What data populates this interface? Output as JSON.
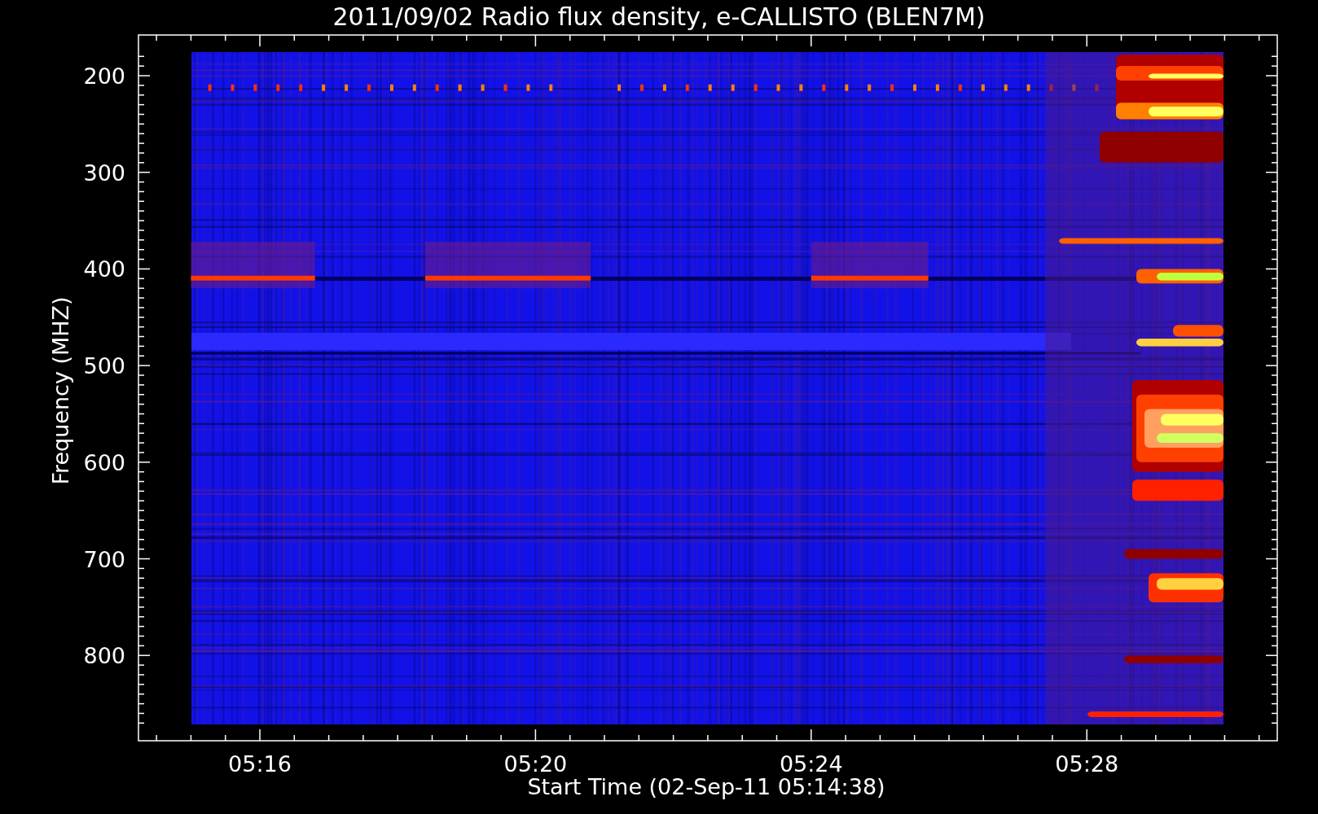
{
  "title": "2011/09/02  Radio flux density, e-CALLISTO (BLEN7M)",
  "ylabel": "Frequency (MHZ)",
  "xlabel": "Start Time (02-Sep-11 05:14:38)",
  "yticks": [
    "200",
    "300",
    "400",
    "500",
    "600",
    "700",
    "800"
  ],
  "xticks": [
    "05:16",
    "05:20",
    "05:24",
    "05:28"
  ]
}
